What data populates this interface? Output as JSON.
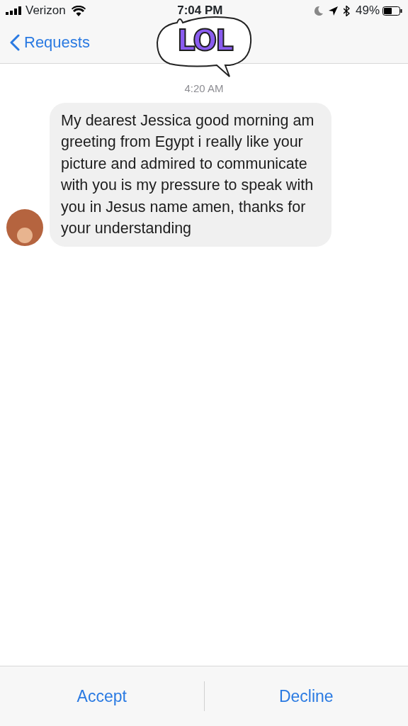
{
  "status_bar": {
    "carrier": "Verizon",
    "time": "7:04 PM",
    "battery": "49%"
  },
  "nav": {
    "back": "Requests"
  },
  "sticker": {
    "text": "LOL"
  },
  "timestamp": "4:20 AM",
  "messages": [
    {
      "text": "My dearest Jessica good morning am greeting from Egypt i really like your picture and admired to communicate with you is my pressure to speak with you in Jesus name amen, thanks for your understanding"
    }
  ],
  "actions": [
    "Accept",
    "Decline"
  ]
}
